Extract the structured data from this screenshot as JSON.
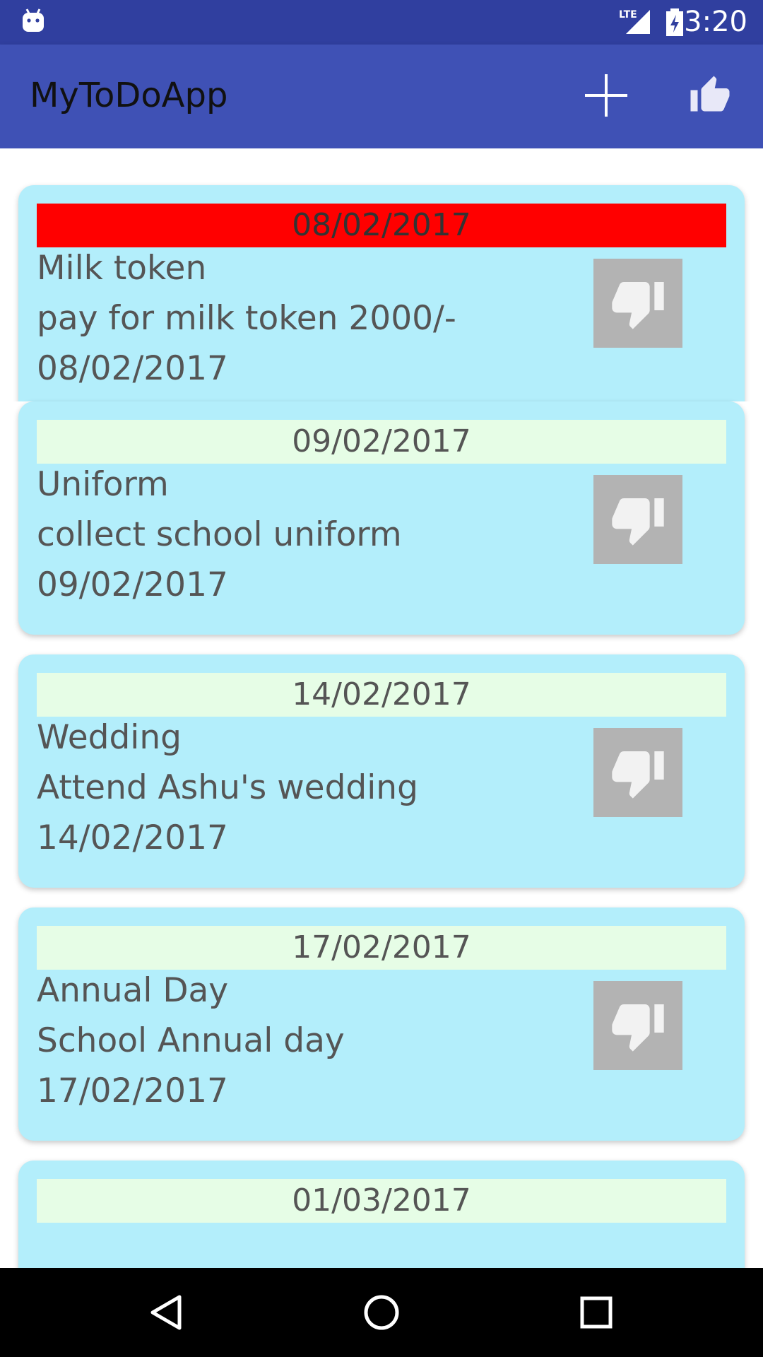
{
  "status_bar": {
    "time": "3:20",
    "network": "LTE"
  },
  "app_bar": {
    "title": "MyToDoApp",
    "actions": [
      "plus-icon",
      "thumbs-up-icon"
    ]
  },
  "todos": [
    {
      "header_date": "08/02/2017",
      "title": "Milk token",
      "description": "pay for milk token 2000/-",
      "date": "08/02/2017",
      "overdue": true,
      "status_icon": "thumbs-down-icon"
    },
    {
      "header_date": "09/02/2017",
      "title": "Uniform",
      "description": "collect school uniform",
      "date": "09/02/2017",
      "overdue": false,
      "status_icon": "thumbs-down-icon"
    },
    {
      "header_date": "14/02/2017",
      "title": "Wedding",
      "description": "Attend Ashu's wedding",
      "date": "14/02/2017",
      "overdue": false,
      "status_icon": "thumbs-down-icon"
    },
    {
      "header_date": "17/02/2017",
      "title": "Annual Day",
      "description": "School Annual day",
      "date": "17/02/2017",
      "overdue": false,
      "status_icon": "thumbs-down-icon"
    },
    {
      "header_date": "01/03/2017",
      "title": "",
      "description": "",
      "date": "",
      "overdue": false,
      "status_icon": ""
    }
  ],
  "colors": {
    "status_bar": "#303f9f",
    "app_bar": "#3f51b5",
    "card": "#b3eefb",
    "date_band": "#e6fde6",
    "date_band_overdue": "#ff0000",
    "dislike_bg": "#b3b3b3"
  },
  "nav_bar": {
    "buttons": [
      "back-icon",
      "home-icon",
      "recents-icon"
    ]
  }
}
